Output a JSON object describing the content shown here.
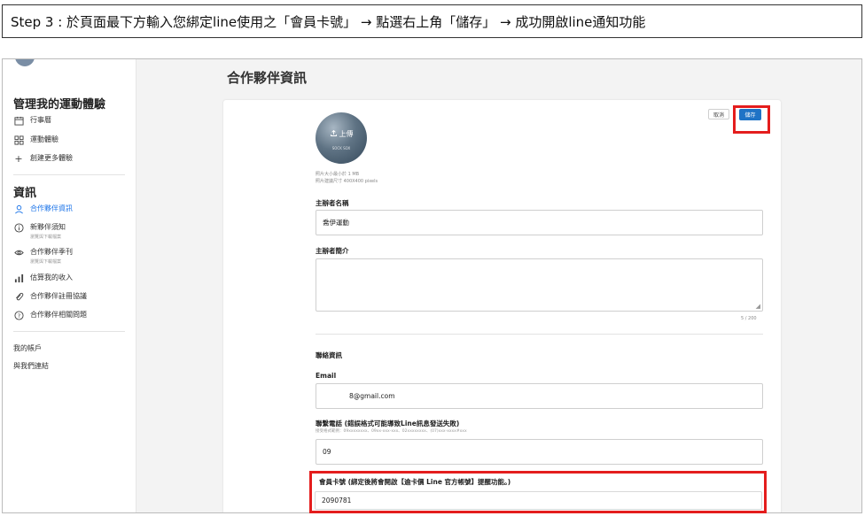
{
  "banner": {
    "text": "Step 3 : 於頁面最下方輸入您綁定line使用之「會員卡號」 → 點選右上角「儲存」 → 成功開啟line通知功能"
  },
  "sidebar": {
    "section_experience": "管理我的運動體驗",
    "experience_items": [
      {
        "label": "行事曆",
        "icon": "calendar-icon"
      },
      {
        "label": "運動體驗",
        "icon": "grid-icon"
      },
      {
        "label": "創建更多體驗",
        "icon": "plus-icon"
      }
    ],
    "section_info": "資訊",
    "info_items": [
      {
        "label": "合作夥伴資訊",
        "icon": "person-icon",
        "active": true
      },
      {
        "label": "新夥伴須知",
        "sub": "瀏覽與下載檔案",
        "icon": "info-icon"
      },
      {
        "label": "合作夥伴季刊",
        "sub": "瀏覽與下載檔案",
        "icon": "eye-icon"
      },
      {
        "label": "估算我的收入",
        "icon": "bar-chart-icon"
      },
      {
        "label": "合作夥伴註冊協議",
        "icon": "paperclip-icon"
      },
      {
        "label": "合作夥伴相關問題",
        "icon": "help-icon"
      }
    ],
    "links": [
      "我的帳戶",
      "與我們連結"
    ]
  },
  "main": {
    "page_title": "合作夥伴資訊",
    "cancel_label": "取消",
    "save_label": "儲存",
    "photo": {
      "upload_label": "上傳",
      "logo_text": "SOCK SOX",
      "hint_size": "照片大小最小於 1 MB",
      "hint_dimensions": "照片建議尺寸 400X400 pixels"
    },
    "organizer_name_label": "主辦者名稱",
    "organizer_name_value": "喬伊運動",
    "organizer_intro_label": "主辦者簡介",
    "organizer_intro_value": "",
    "intro_counter": "5 / 200",
    "contact_section": "聯絡資訊",
    "email_label": "Email",
    "email_value": "8@gmail.com",
    "phone_label": "聯繫電話 (錯誤格式可能導致Line訊息發送失敗)",
    "phone_hint": "接受格式範例：09xxxxxxxx、09xx-xxx-xxx、02xxxxxxxx、(07)xxx-xxxx#xxx",
    "phone_value": "09",
    "member_label": "會員卡號 (綁定後將會開啟【逾卡價 Line 官方帳號】提醒功能。)",
    "member_value": "2090781"
  },
  "colors": {
    "highlight": "#e41d1d",
    "primary_button": "#1f73c6",
    "active_nav": "#1a73e8"
  }
}
